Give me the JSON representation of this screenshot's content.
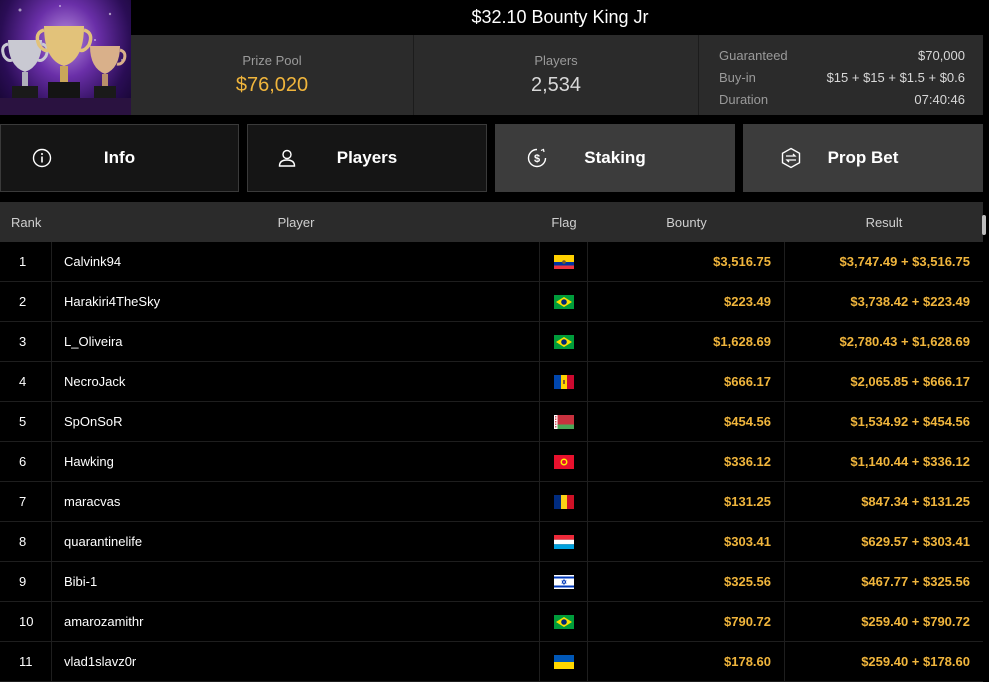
{
  "header": {
    "title": "$32.10 Bounty King Jr",
    "prize_pool_label": "Prize Pool",
    "prize_pool_value": "$76,020",
    "players_label": "Players",
    "players_value": "2,534",
    "details": [
      {
        "key": "Guaranteed",
        "value": "$70,000"
      },
      {
        "key": "Buy-in",
        "value": "$15 + $15 + $1.5 + $0.6"
      },
      {
        "key": "Duration",
        "value": "07:40:46"
      }
    ]
  },
  "tabs": [
    {
      "label": "Info",
      "icon": "info-icon",
      "active": false
    },
    {
      "label": "Players",
      "icon": "user-icon",
      "active": false
    },
    {
      "label": "Staking",
      "icon": "dollar-coin-icon",
      "active": true
    },
    {
      "label": "Prop Bet",
      "icon": "prop-bet-icon",
      "active": true
    }
  ],
  "table": {
    "headers": {
      "rank": "Rank",
      "player": "Player",
      "flag": "Flag",
      "bounty": "Bounty",
      "result": "Result"
    },
    "rows": [
      {
        "rank": "1",
        "player": "Calvink94",
        "flag": "Ecuador",
        "bounty": "$3,516.75",
        "result": "$3,747.49 + $3,516.75"
      },
      {
        "rank": "2",
        "player": "Harakiri4TheSky",
        "flag": "Brazil",
        "bounty": "$223.49",
        "result": "$3,738.42 + $223.49"
      },
      {
        "rank": "3",
        "player": "L_Oliveira",
        "flag": "Brazil",
        "bounty": "$1,628.69",
        "result": "$2,780.43 + $1,628.69"
      },
      {
        "rank": "4",
        "player": "NecroJack",
        "flag": "Moldova",
        "bounty": "$666.17",
        "result": "$2,065.85 + $666.17"
      },
      {
        "rank": "5",
        "player": "SpOnSoR",
        "flag": "Belarus",
        "bounty": "$454.56",
        "result": "$1,534.92 + $454.56"
      },
      {
        "rank": "6",
        "player": "Hawking",
        "flag": "Kyrgyzstan",
        "bounty": "$336.12",
        "result": "$1,140.44 + $336.12"
      },
      {
        "rank": "7",
        "player": "maracvas",
        "flag": "Romania",
        "bounty": "$131.25",
        "result": "$847.34 + $131.25"
      },
      {
        "rank": "8",
        "player": "quarantinelife",
        "flag": "Luxembourg",
        "bounty": "$303.41",
        "result": "$629.57 + $303.41"
      },
      {
        "rank": "9",
        "player": "Bibi-1",
        "flag": "Israel",
        "bounty": "$325.56",
        "result": "$467.77 + $325.56"
      },
      {
        "rank": "10",
        "player": "amarozamithr",
        "flag": "Brazil",
        "bounty": "$790.72",
        "result": "$259.40 + $790.72"
      },
      {
        "rank": "11",
        "player": "vlad1slavz0r",
        "flag": "Ukraine",
        "bounty": "$178.60",
        "result": "$259.40 + $178.60"
      }
    ]
  },
  "colors": {
    "accent_gold": "#f0b53c",
    "panel": "#2b2b2b",
    "active_tab": "#3c3c3c"
  }
}
